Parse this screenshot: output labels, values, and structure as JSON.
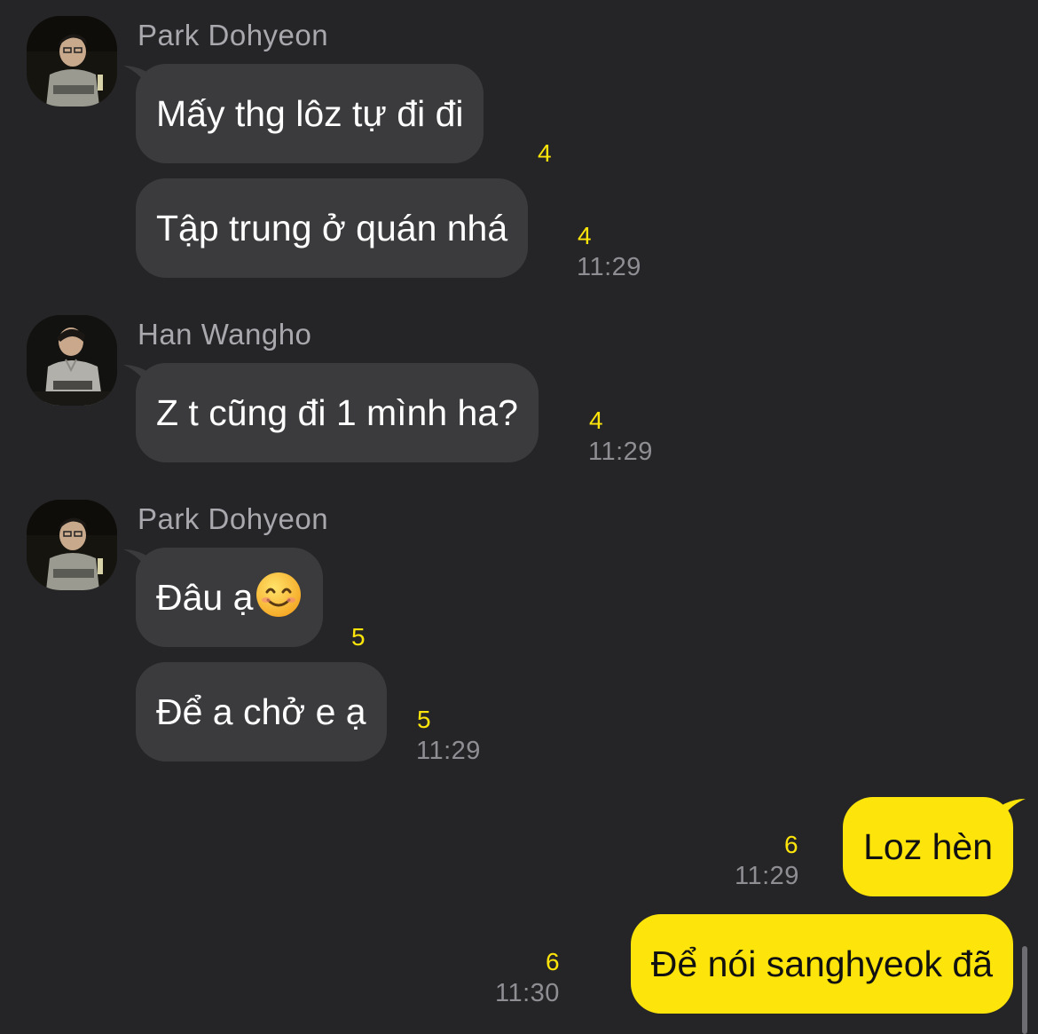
{
  "colors": {
    "background": "#252527",
    "incoming_bubble": "#3b3b3e",
    "outgoing_bubble": "#fde40b",
    "unread_count": "#fde40b",
    "sender_name": "#a8a8ad",
    "timestamp": "#8e8e93"
  },
  "groups": [
    {
      "sender": "Park Dohyeon",
      "avatar": "avatar-photo-icon",
      "messages": [
        {
          "text": "Mấy thg lôz tự đi đi",
          "unread": "4",
          "time": ""
        },
        {
          "text": "Tập trung ở quán nhá",
          "unread": "4",
          "time": "11:29"
        }
      ]
    },
    {
      "sender": "Han Wangho",
      "avatar": "avatar-photo-icon",
      "messages": [
        {
          "text": "Z t cũng đi 1 mình ha?",
          "unread": "4",
          "time": "11:29"
        }
      ]
    },
    {
      "sender": "Park Dohyeon",
      "avatar": "avatar-photo-icon",
      "messages": [
        {
          "text": "Đâu ạ",
          "emoji": "smiling-face-icon",
          "unread": "5",
          "time": ""
        },
        {
          "text": "Để a chở e ạ",
          "unread": "5",
          "time": "11:29"
        }
      ]
    }
  ],
  "outgoing": [
    {
      "text": "Loz hèn",
      "unread": "6",
      "time": "11:29"
    },
    {
      "text": "Để nói sanghyeok đã",
      "unread": "6",
      "time": "11:30"
    }
  ]
}
